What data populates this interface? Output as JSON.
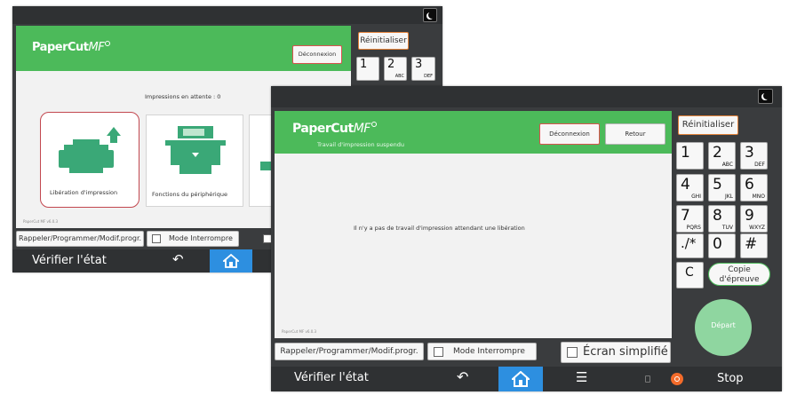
{
  "back_panel": {
    "logo_main": "PaperCut",
    "logo_mf": "MF",
    "logout_label": "Déconnexion",
    "reset_label": "Réinitialiser",
    "pending_text": "Impressions en attente : 0",
    "tiles": [
      {
        "label": "Libération d'impression"
      },
      {
        "label": "Fonctions du périphérique"
      }
    ],
    "version": "PaperCut MF v6.0.3",
    "recall_label": "Rappeler/Programmer/Modif.progr.",
    "interrupt_label": "Mode Interrompre",
    "status_label": "Vérifier l'état",
    "keys": [
      {
        "big": "1",
        "sub": ""
      },
      {
        "big": "2",
        "sub": "ABC"
      },
      {
        "big": "3",
        "sub": "DEF"
      }
    ]
  },
  "front_panel": {
    "logo_main": "PaperCut",
    "logo_mf": "MF",
    "subtitle": "Travail d'impression suspendu",
    "logout_label": "Déconnexion",
    "back_label": "Retour",
    "reset_label": "Réinitialiser",
    "message": "Il n'y a pas de travail d'impression attendant une libération",
    "version": "PaperCut MF v6.0.3",
    "recall_label": "Rappeler/Programmer/Modif.progr.",
    "interrupt_label": "Mode Interrompre",
    "simplified_label": "Écran simplifié",
    "status_label": "Vérifier l'état",
    "stop_label": "Stop",
    "start_label": "Départ",
    "proof_copy_label": "Copie d'épreuve",
    "clear_label": "C",
    "keys": [
      {
        "big": "1",
        "sub": ""
      },
      {
        "big": "2",
        "sub": "ABC"
      },
      {
        "big": "3",
        "sub": "DEF"
      },
      {
        "big": "4",
        "sub": "GHI"
      },
      {
        "big": "5",
        "sub": "JKL"
      },
      {
        "big": "6",
        "sub": "MNO"
      },
      {
        "big": "7",
        "sub": "PQRS"
      },
      {
        "big": "8",
        "sub": "TUV"
      },
      {
        "big": "9",
        "sub": "WXYZ"
      },
      {
        "big": "./*",
        "sub": ""
      },
      {
        "big": "0",
        "sub": ""
      },
      {
        "big": "#",
        "sub": ""
      }
    ]
  },
  "colors": {
    "brand_green": "#4cba5a",
    "frame": "#3a3c3e",
    "home_blue": "#2d8fe0",
    "highlight_orange": "#e2823a",
    "highlight_red": "#d9534f",
    "start_green": "#8fd6a0"
  }
}
